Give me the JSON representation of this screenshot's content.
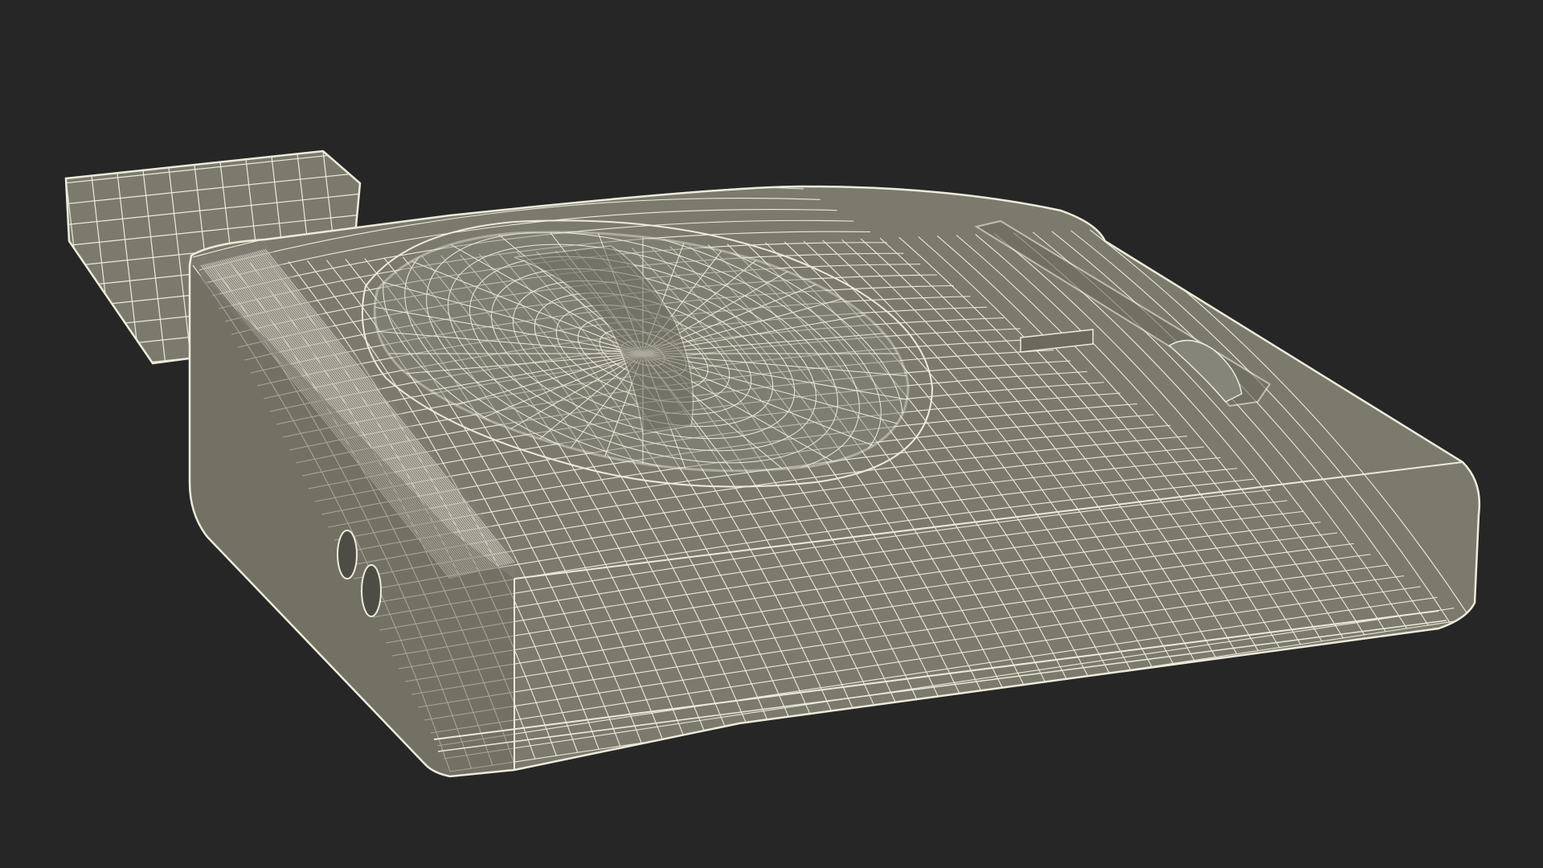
{
  "scene": {
    "subject": "wireframe-console-model",
    "colors": {
      "background": "#262626",
      "surface": "#7b7a6c",
      "surface_dark": "#6b6a5d",
      "surface_light": "#86857a",
      "wire": "#ecebdb"
    }
  }
}
